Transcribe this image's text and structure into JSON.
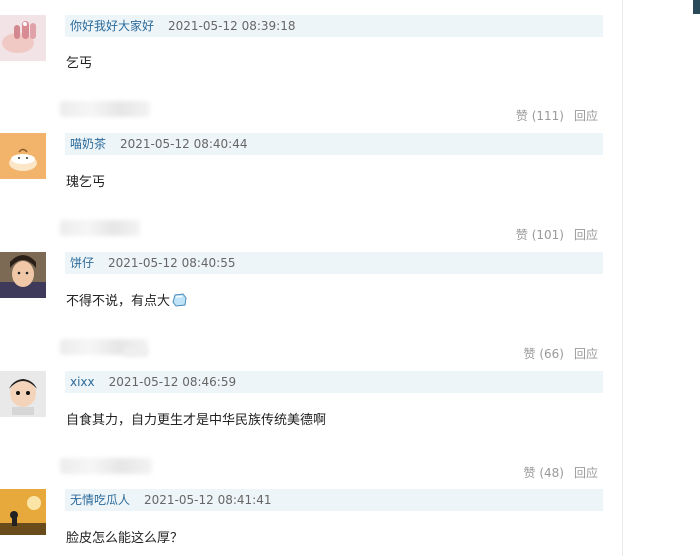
{
  "comments": [
    {
      "user": "你好我好大家好",
      "time": "2021-05-12 08:39:18",
      "text": "乞丐",
      "likes": "赞 (111)",
      "reply": "回应"
    },
    {
      "user": "喵奶茶",
      "time": "2021-05-12 08:40:44",
      "text": "瑰乞丐",
      "likes": "赞 (101)",
      "reply": "回应"
    },
    {
      "user": "饼仔",
      "time": "2021-05-12 08:40:55",
      "text": "不得不说，有点大",
      "likes": "赞 (66)",
      "reply": "回应"
    },
    {
      "user": "xixx",
      "time": "2021-05-12 08:46:59",
      "text": "自食其力，自力更生才是中华民族传统美德啊",
      "likes": "赞 (48)",
      "reply": "回应"
    },
    {
      "user": "无情吃瓜人",
      "time": "2021-05-12 08:41:41",
      "text": "脸皮怎么能这么厚？"
    }
  ],
  "icons": {
    "emoji": "ice-cube-emoji"
  },
  "colors": {
    "meta_bg": "#eef5f8",
    "username": "#2b6a9a",
    "action_text": "#999999"
  }
}
